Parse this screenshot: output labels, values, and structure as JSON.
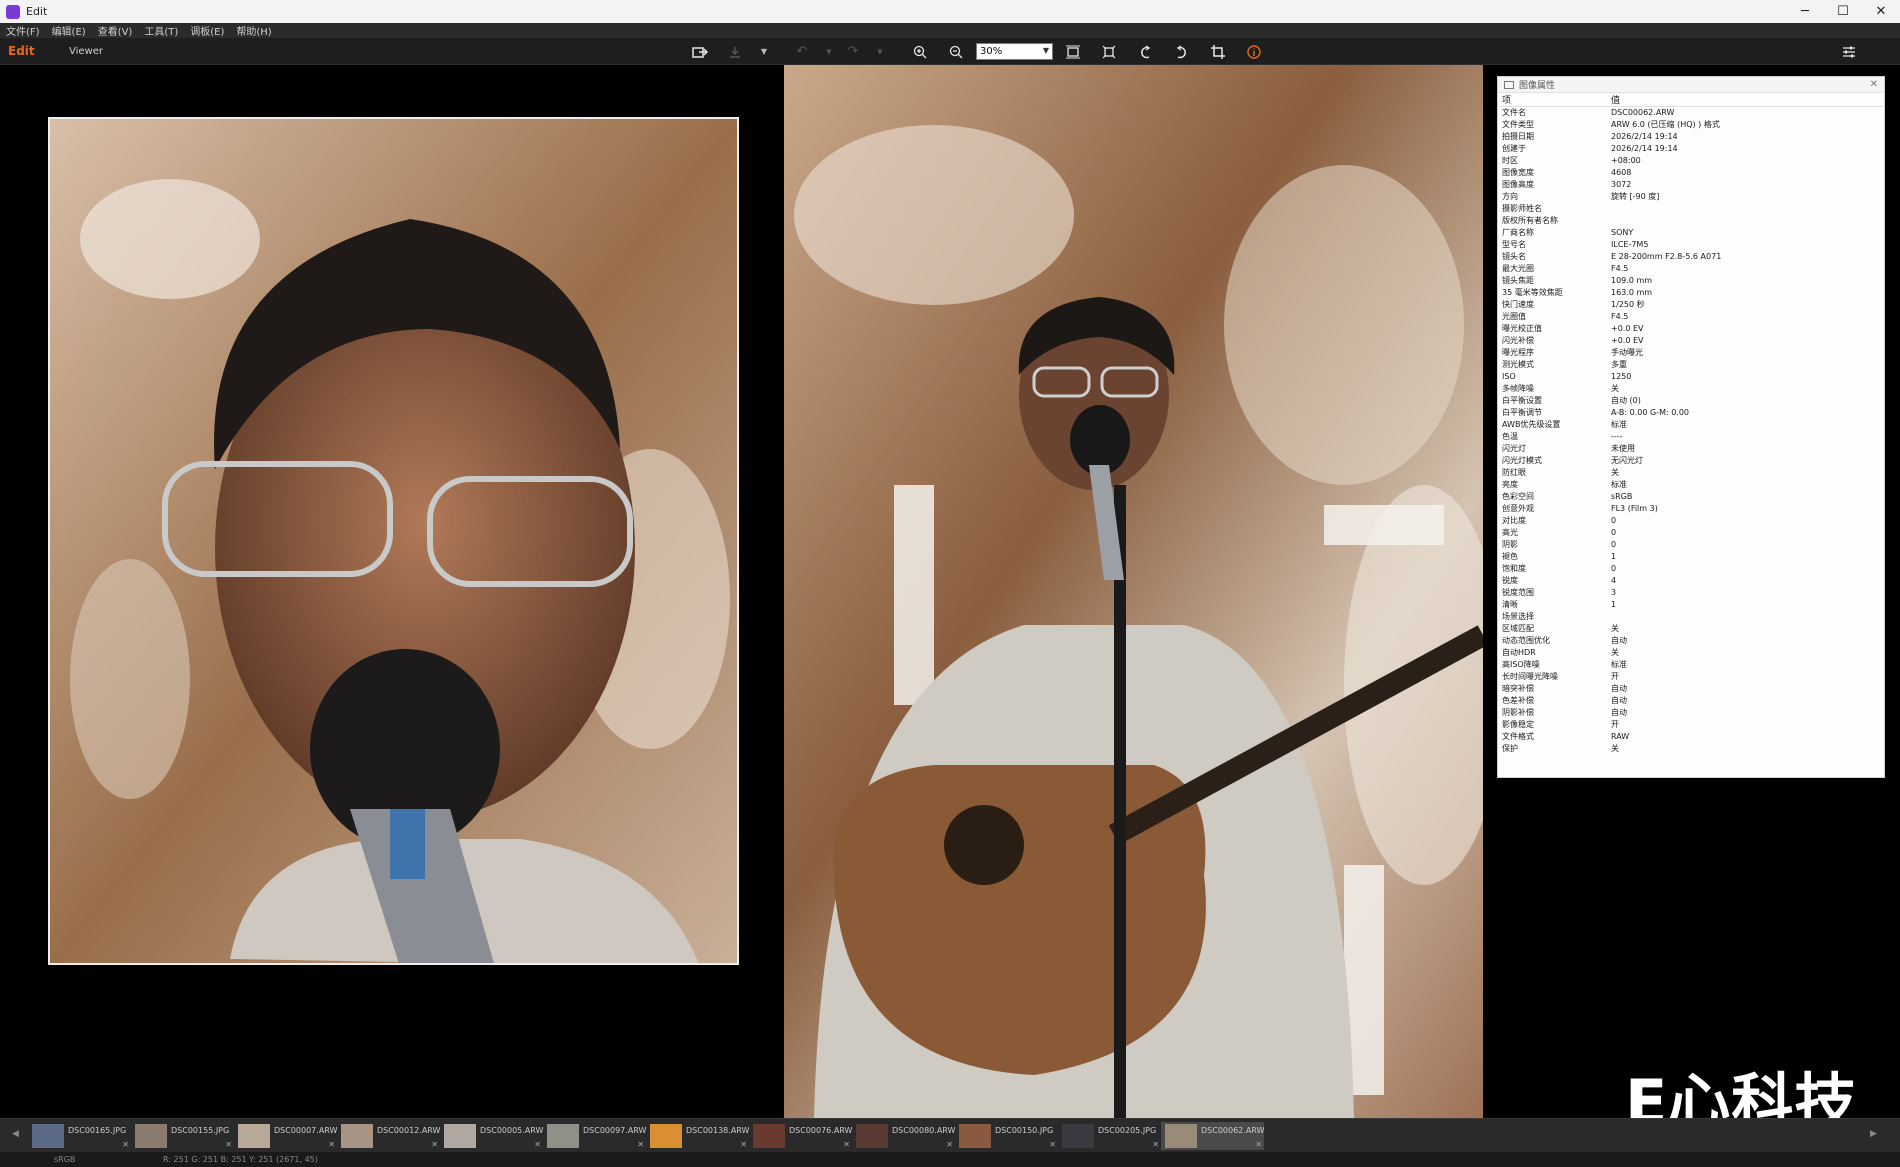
{
  "window": {
    "title": "Edit",
    "minimize": "─",
    "maximize": "☐",
    "close": "✕"
  },
  "menu": [
    "文件(F)",
    "编辑(E)",
    "查看(V)",
    "工具(T)",
    "调板(E)",
    "帮助(H)"
  ],
  "toolbar": {
    "edit_label": "Edit",
    "viewer_label": "Viewer",
    "zoom_value": "30%",
    "icons": [
      "export-icon",
      "save-icon",
      "dropdown-icon",
      "undo-icon",
      "undo-dropdown-icon",
      "redo-icon",
      "redo-dropdown-icon",
      "zoom-in-icon",
      "zoom-out-icon",
      "fit-window-icon",
      "actual-size-icon",
      "rotate-left-icon",
      "rotate-right-icon",
      "crop-icon",
      "info-icon",
      "settings-icon"
    ]
  },
  "properties": {
    "title": "图像属性",
    "col_key": "项",
    "col_value": "值",
    "rows": [
      {
        "k": "文件名",
        "v": "DSC00062.ARW"
      },
      {
        "k": "文件类型",
        "v": "ARW 6.0 (已压缩 (HQ) ) 格式"
      },
      {
        "k": "拍摄日期",
        "v": "2026/2/14 19:14"
      },
      {
        "k": "创建于",
        "v": "2026/2/14 19:14"
      },
      {
        "k": "时区",
        "v": "+08:00"
      },
      {
        "k": "图像宽度",
        "v": "4608"
      },
      {
        "k": "图像高度",
        "v": "3072"
      },
      {
        "k": "方向",
        "v": "旋转 [-90 度]"
      },
      {
        "k": "摄影师姓名",
        "v": ""
      },
      {
        "k": "版权所有者名称",
        "v": ""
      },
      {
        "k": "厂商名称",
        "v": "SONY"
      },
      {
        "k": "型号名",
        "v": "ILCE-7M5"
      },
      {
        "k": "镜头名",
        "v": "E 28-200mm F2.8-5.6 A071"
      },
      {
        "k": "最大光圈",
        "v": "F4.5"
      },
      {
        "k": "镜头焦距",
        "v": "109.0 mm"
      },
      {
        "k": "35 毫米等效焦距",
        "v": "163.0 mm"
      },
      {
        "k": "快门速度",
        "v": "1/250 秒"
      },
      {
        "k": "光圈值",
        "v": "F4.5"
      },
      {
        "k": "曝光校正值",
        "v": "+0.0 EV"
      },
      {
        "k": "闪光补偿",
        "v": "+0.0 EV"
      },
      {
        "k": "曝光程序",
        "v": "手动曝光"
      },
      {
        "k": "测光模式",
        "v": "多重"
      },
      {
        "k": "ISO",
        "v": "1250"
      },
      {
        "k": "多帧降噪",
        "v": "关"
      },
      {
        "k": "白平衡设置",
        "v": "自动 (0)"
      },
      {
        "k": "白平衡调节",
        "v": "A-B: 0.00 G-M: 0.00"
      },
      {
        "k": "AWB优先级设置",
        "v": "标准"
      },
      {
        "k": "色温",
        "v": "----"
      },
      {
        "k": "闪光灯",
        "v": "未使用"
      },
      {
        "k": "闪光灯模式",
        "v": "无闪光灯"
      },
      {
        "k": "防红眼",
        "v": "关"
      },
      {
        "k": "亮度",
        "v": "标准"
      },
      {
        "k": "色彩空间",
        "v": "sRGB"
      },
      {
        "k": "创意外观",
        "v": "FL3 (Film 3)"
      },
      {
        "k": "对比度",
        "v": "0"
      },
      {
        "k": "高光",
        "v": "0"
      },
      {
        "k": "阴影",
        "v": "0"
      },
      {
        "k": "褪色",
        "v": "1"
      },
      {
        "k": "饱和度",
        "v": "0"
      },
      {
        "k": "锐度",
        "v": "4"
      },
      {
        "k": "锐度范围",
        "v": "3"
      },
      {
        "k": "清晰",
        "v": "1"
      },
      {
        "k": "场景选择",
        "v": ""
      },
      {
        "k": "区域匹配",
        "v": "关"
      },
      {
        "k": "动态范围优化",
        "v": "自动"
      },
      {
        "k": "自动HDR",
        "v": "关"
      },
      {
        "k": "高ISO降噪",
        "v": "标准"
      },
      {
        "k": "长时间曝光降噪",
        "v": "开"
      },
      {
        "k": "暗突补偿",
        "v": "自动"
      },
      {
        "k": "色差补偿",
        "v": "自动"
      },
      {
        "k": "阴影补偿",
        "v": "自动"
      },
      {
        "k": "影像稳定",
        "v": "开"
      },
      {
        "k": "文件格式",
        "v": "RAW"
      },
      {
        "k": "保护",
        "v": "关"
      }
    ]
  },
  "watermark": "E心科技",
  "filmstrip": [
    {
      "name": "DSC00165.JPG",
      "color": "#5a6a88"
    },
    {
      "name": "DSC00155.JPG",
      "color": "#8a7a70"
    },
    {
      "name": "DSC00007.ARW",
      "color": "#b8a898"
    },
    {
      "name": "DSC00012.ARW",
      "color": "#a89484"
    },
    {
      "name": "DSC00005.ARW",
      "color": "#b0a8a0"
    },
    {
      "name": "DSC00097.ARW",
      "color": "#909088"
    },
    {
      "name": "DSC00138.ARW",
      "color": "#d89030"
    },
    {
      "name": "DSC00076.ARW",
      "color": "#6a3a30"
    },
    {
      "name": "DSC00080.ARW",
      "color": "#5a3a34"
    },
    {
      "name": "DSC00150.JPG",
      "color": "#8a5a40"
    },
    {
      "name": "DSC00205.JPG",
      "color": "#3a3a40"
    },
    {
      "name": "DSC00062.ARW",
      "color": "#9a8a78"
    }
  ],
  "status": {
    "colorspace": "sRGB",
    "pixel": "R: 251  G: 251  B: 251  Y: 251",
    "coords": "(2671,  45)"
  }
}
